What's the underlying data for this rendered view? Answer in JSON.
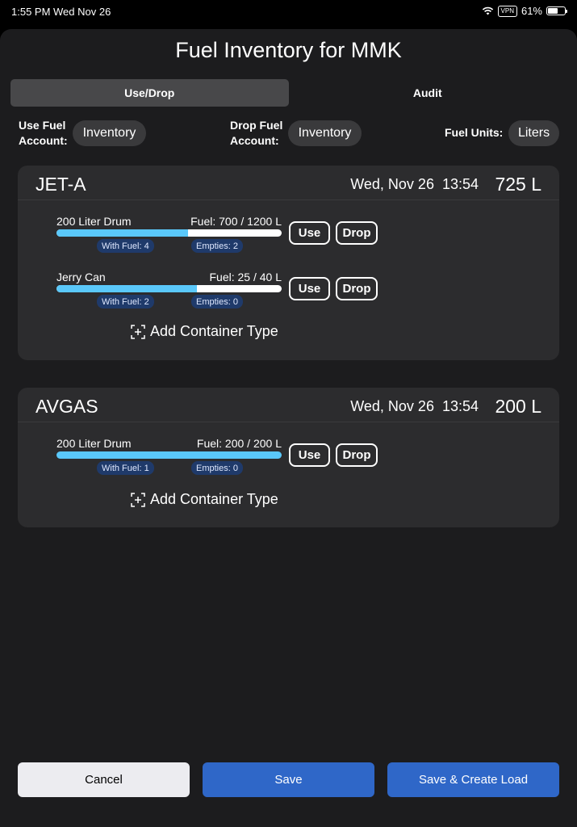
{
  "status_bar": {
    "time": "1:55 PM",
    "date": "Wed Nov 26",
    "vpn": "VPN",
    "battery": "61%",
    "battery_level": 0.61
  },
  "title": "Fuel Inventory for MMK",
  "tabs": [
    {
      "label": "Use/Drop",
      "active": true
    },
    {
      "label": "Audit",
      "active": false
    }
  ],
  "accounts": {
    "use_label": "Use Fuel\nAccount:",
    "use_value": "Inventory",
    "drop_label": "Drop Fuel\nAccount:",
    "drop_value": "Inventory",
    "units_label": "Fuel Units:",
    "units_value": "Liters"
  },
  "fuels": [
    {
      "name": "JET-A",
      "date": "Wed, Nov 26  13:54",
      "total": "725 L",
      "containers": [
        {
          "name": "200 Liter Drum",
          "fuel": "Fuel: 700 / 1200 L",
          "fill": 0.583,
          "with_fuel": "With Fuel: 4",
          "empties": "Empties: 2",
          "use": "Use",
          "drop": "Drop"
        },
        {
          "name": "Jerry Can",
          "fuel": "Fuel: 25 / 40 L",
          "fill": 0.625,
          "with_fuel": "With Fuel: 2",
          "empties": "Empties: 0",
          "use": "Use",
          "drop": "Drop"
        }
      ],
      "add_label": "Add Container Type"
    },
    {
      "name": "AVGAS",
      "date": "Wed, Nov 26  13:54",
      "total": "200 L",
      "containers": [
        {
          "name": "200 Liter Drum",
          "fuel": "Fuel: 200 / 200 L",
          "fill": 1.0,
          "with_fuel": "With Fuel: 1",
          "empties": "Empties: 0",
          "use": "Use",
          "drop": "Drop"
        }
      ],
      "add_label": "Add Container Type"
    }
  ],
  "buttons": {
    "cancel": "Cancel",
    "save": "Save",
    "save_create_load": "Save & Create Load"
  },
  "colors": {
    "background": "#1c1c1e",
    "card": "#2c2c2e",
    "accent_blue": "#2f67c8",
    "bar_fill": "#5ac8fa",
    "chip": "#1f3a6a"
  }
}
